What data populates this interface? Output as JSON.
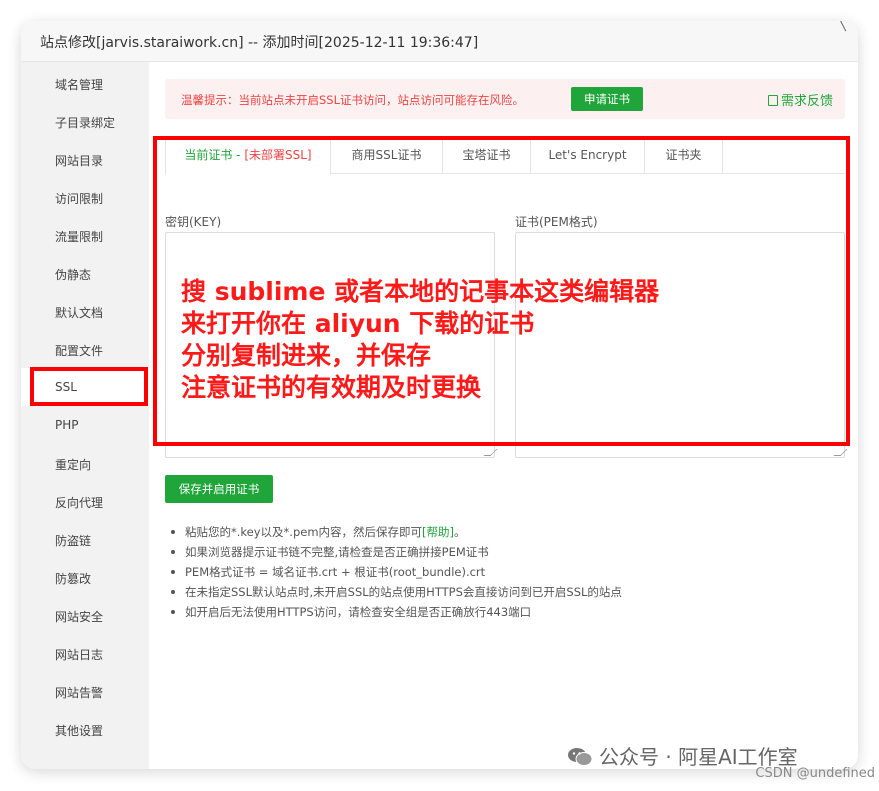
{
  "window": {
    "title": "站点修改[jarvis.staraiwork.cn] -- 添加时间[2025-12-11 19:36:47]"
  },
  "sidebar": {
    "items": [
      {
        "label": "域名管理"
      },
      {
        "label": "子目录绑定"
      },
      {
        "label": "网站目录"
      },
      {
        "label": "访问限制"
      },
      {
        "label": "流量限制"
      },
      {
        "label": "伪静态"
      },
      {
        "label": "默认文档"
      },
      {
        "label": "配置文件"
      },
      {
        "label": "SSL"
      },
      {
        "label": "PHP"
      },
      {
        "label": "重定向"
      },
      {
        "label": "反向代理"
      },
      {
        "label": "防盗链"
      },
      {
        "label": "防篡改"
      },
      {
        "label": "网站安全"
      },
      {
        "label": "网站日志"
      },
      {
        "label": "网站告警"
      },
      {
        "label": "其他设置"
      }
    ],
    "active": "SSL"
  },
  "alert": {
    "text": "温馨提示：当前站点未开启SSL证书访问，站点访问可能存在风险。",
    "apply_button": "申请证书",
    "feedback": "需求反馈"
  },
  "tabs": {
    "items": [
      {
        "label": "当前证书 - ",
        "warn": "[未部署SSL]"
      },
      {
        "label": "商用SSL证书"
      },
      {
        "label": "宝塔证书"
      },
      {
        "label": "Let's Encrypt"
      },
      {
        "label": "证书夹"
      }
    ]
  },
  "form": {
    "key_label": "密钥(KEY)",
    "cert_label": "证书(PEM格式)",
    "key_value": "",
    "cert_value": "",
    "save_button": "保存并启用证书"
  },
  "annotation": {
    "lines": [
      "搜 sublime 或者本地的记事本这类编辑器",
      "来打开你在 aliyun 下载的证书",
      "分别复制进来，并保存",
      "注意证书的有效期及时更换"
    ]
  },
  "tips": {
    "items": [
      {
        "text": "粘贴您的*.key以及*.pem内容，然后保存即可",
        "link": "[帮助]",
        "suffix": "。"
      },
      {
        "text": "如果浏览器提示证书链不完整,请检查是否正确拼接PEM证书"
      },
      {
        "text": "PEM格式证书 = 域名证书.crt + 根证书(root_bundle).crt"
      },
      {
        "text": "在未指定SSL默认站点时,未开启SSL的站点使用HTTPS会直接访问到已开启SSL的站点"
      },
      {
        "text": "如开启后无法使用HTTPS访问，请检查安全组是否正确放行443端口"
      }
    ]
  },
  "watermark": {
    "text": "公众号 · 阿星AI工作室",
    "icon": "wechat-icon",
    "credit": "CSDN @undefined"
  },
  "colors": {
    "brand_green": "#20a53a",
    "alert_red": "#ef4444",
    "annotation_red": "#ff0000"
  }
}
